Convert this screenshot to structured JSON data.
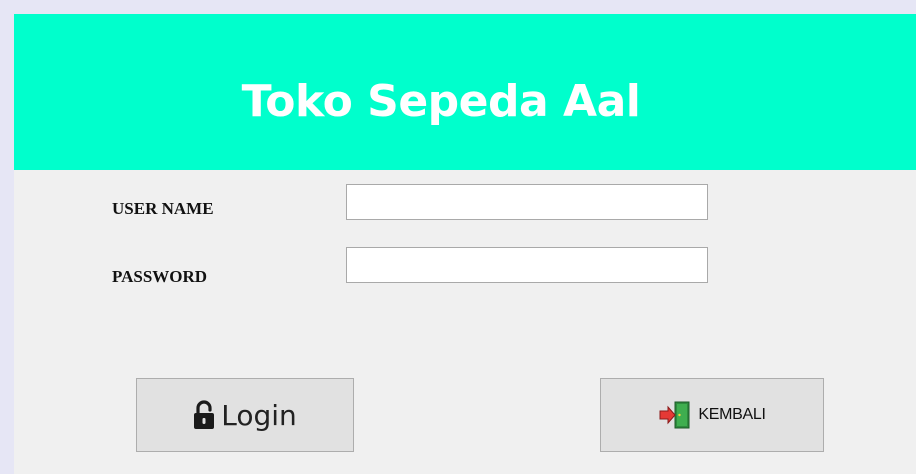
{
  "header": {
    "title": "Toko Sepeda Aal",
    "background_color": "#00ffcc"
  },
  "form": {
    "username_label": "USER NAME",
    "username_value": "",
    "password_label": "PASSWORD",
    "password_value": ""
  },
  "buttons": {
    "login_label": "Login",
    "login_icon": "lock-icon",
    "back_label": "KEMBALI",
    "back_icon": "exit-door-icon"
  }
}
